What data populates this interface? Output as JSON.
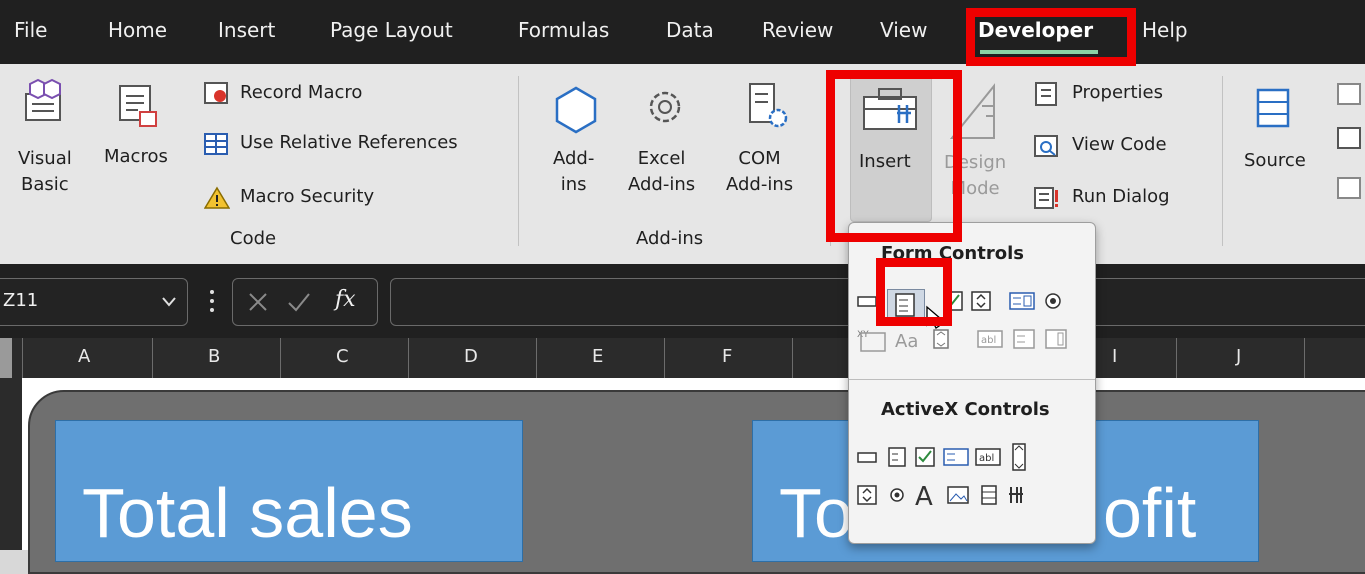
{
  "tabs": [
    "File",
    "Home",
    "Insert",
    "Page Layout",
    "Formulas",
    "Data",
    "Review",
    "View",
    "Developer",
    "Help"
  ],
  "code_group": {
    "visual_basic": "Visual\nBasic",
    "macros": "Macros",
    "record_macro": "Record Macro",
    "use_relative_references": "Use Relative References",
    "macro_security": "Macro Security",
    "label": "Code"
  },
  "addins_group": {
    "addins": "Add-\nins",
    "excel_addins": "Excel\nAdd-ins",
    "com_addins": "COM\nAdd-ins",
    "label": "Add-ins"
  },
  "controls_group": {
    "insert": "Insert",
    "design_mode": "Design\nMode",
    "properties": "Properties",
    "view_code": "View Code",
    "run_dialog": "Run Dialog"
  },
  "xml_group": {
    "source": "Source"
  },
  "formula_bar": {
    "name_box": "Z11",
    "fx": "fx"
  },
  "columns": [
    "A",
    "B",
    "C",
    "D",
    "E",
    "F",
    "I",
    "J"
  ],
  "dropdown": {
    "form_controls_title": "Form Controls",
    "activex_controls_title": "ActiveX Controls"
  },
  "sheet": {
    "tile1_text": "Total sales",
    "tile2_left_text": "To",
    "tile2_right_text": "ofit"
  },
  "colors": {
    "highlight_red": "#ee0000",
    "tile_blue": "#5b9bd5",
    "tab_underline": "#8bd3a6"
  }
}
